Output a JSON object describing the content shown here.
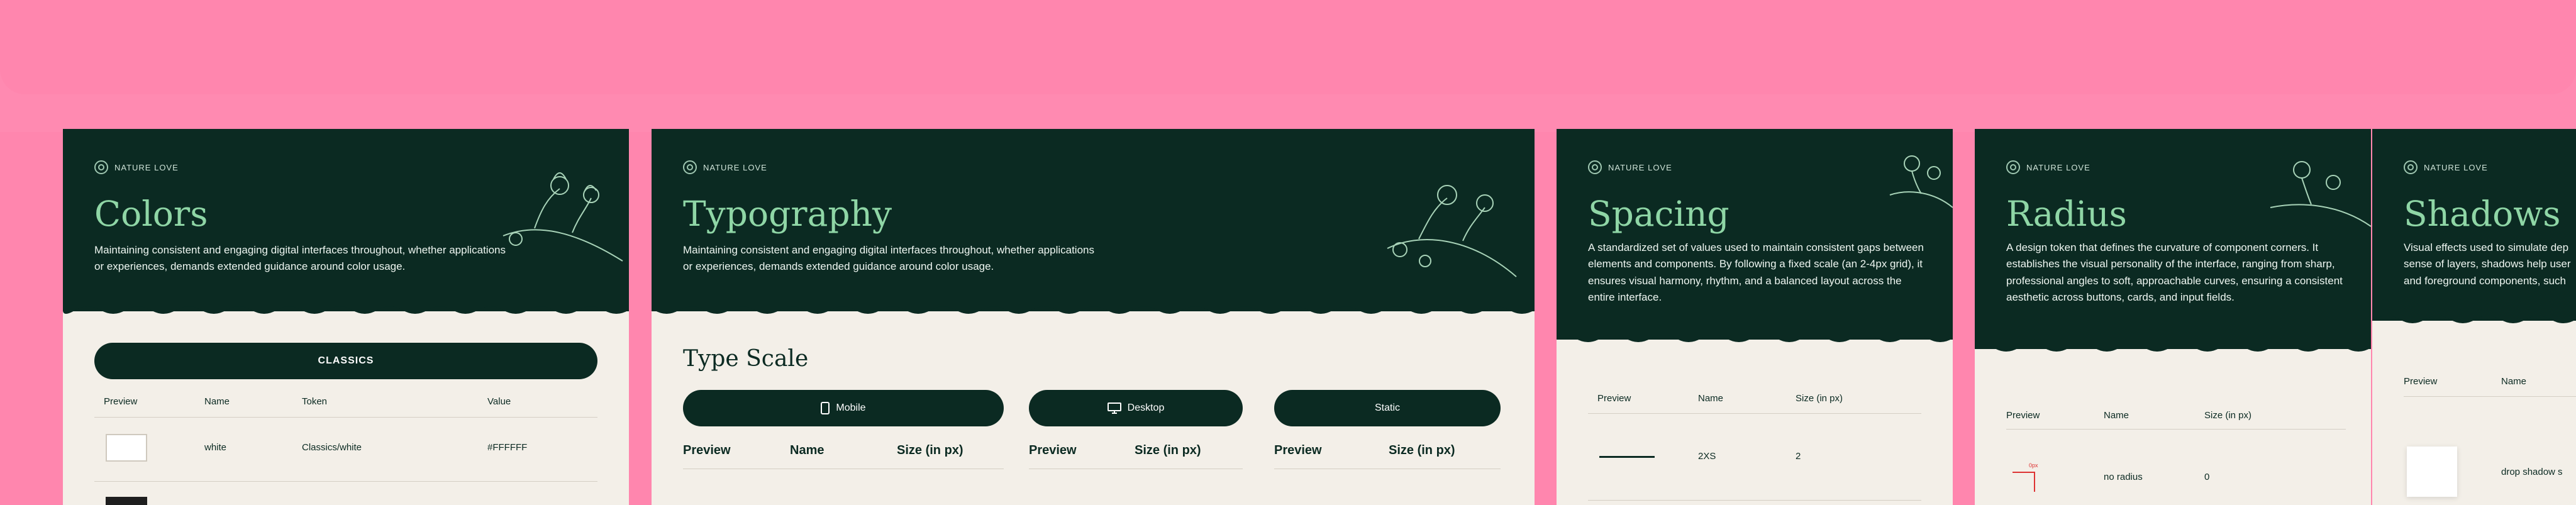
{
  "brand": {
    "name": "NATURE LOVE"
  },
  "cards": {
    "colors": {
      "title": "Colors",
      "description": "Maintaining consistent and engaging digital interfaces throughout, whether applications or experiences, demands extended guidance around color usage.",
      "tab_label": "CLASSICS",
      "columns": [
        "Preview",
        "Name",
        "Token",
        "Value"
      ],
      "rows": [
        {
          "name": "white",
          "token": "Classics/white",
          "value": "#FFFFFF"
        }
      ]
    },
    "typography": {
      "title": "Typography",
      "description": "Maintaining consistent and engaging digital interfaces throughout, whether applications or experiences, demands extended guidance around color usage.",
      "section_title": "Type Scale",
      "tabs": [
        {
          "label": "Mobile",
          "icon": "mobile-icon"
        },
        {
          "label": "Desktop",
          "icon": "desktop-icon"
        },
        {
          "label": "Static",
          "icon": ""
        }
      ],
      "col_mobile": [
        "Preview",
        "Name",
        "Size (in px)"
      ],
      "col_desktop": [
        "Preview",
        "Size (in px)"
      ],
      "col_static": [
        "Preview",
        "Size (in px)"
      ]
    },
    "spacing": {
      "title": "Spacing",
      "description": "A standardized set of values used to maintain consistent gaps between elements and components. By following a fixed scale (an 2-4px grid), it ensures visual harmony, rhythm, and a balanced layout across the entire interface.",
      "columns": [
        "Preview",
        "Name",
        "Size (in px)"
      ],
      "rows": [
        {
          "name": "2XS",
          "size": "2"
        }
      ]
    },
    "radius": {
      "title": "Radius",
      "description": "A design token that defines the curvature of component corners. It establishes the visual personality of the interface, ranging from sharp, professional angles to soft, approachable curves, ensuring a consistent aesthetic across buttons, cards, and input fields.",
      "columns": [
        "Preview",
        "Name",
        "Size (in px)"
      ],
      "rows": [
        {
          "name": "no radius",
          "size": "0",
          "marker": "0px"
        }
      ]
    },
    "shadows": {
      "title": "Shadows",
      "description_lines": [
        "Visual effects used to simulate dep",
        "sense of layers, shadows help user",
        "and foreground components, such"
      ],
      "columns": [
        "Preview",
        "Name"
      ],
      "rows": [
        {
          "name": "drop shadow s"
        }
      ]
    }
  },
  "colors": {
    "background": "#FF86AE",
    "hero": "#0B2A22",
    "title_green": "#8FD6A6",
    "card_bg": "#F3EFE8"
  }
}
